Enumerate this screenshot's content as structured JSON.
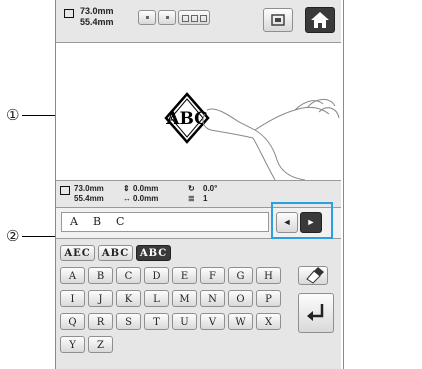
{
  "header": {
    "width": "73.0mm",
    "height": "55.4mm",
    "mode_buttons": [
      "",
      "",
      ""
    ],
    "icons": [
      "embroidery-frame-icon",
      "home-icon"
    ]
  },
  "canvas": {
    "monogram_text": "ABC",
    "annotation": "①"
  },
  "info_bar": {
    "width": "73.0mm",
    "height": "55.4mm",
    "offset_vertical": "0.0mm",
    "offset_horizontal": "0.0mm",
    "rotation": "0.0°",
    "color_count": "1"
  },
  "input": {
    "entered_chars": [
      "A",
      "B",
      "C"
    ],
    "arrow_left": "◄",
    "arrow_right": "►",
    "annotation": "②"
  },
  "keyboard": {
    "tabs": [
      "AEC",
      "ABC",
      "ABC"
    ],
    "selected_tab": 2,
    "rows": [
      [
        "A",
        "B",
        "C",
        "D",
        "E",
        "F",
        "G",
        "H"
      ],
      [
        "I",
        "J",
        "K",
        "L",
        "M",
        "N",
        "O",
        "P"
      ],
      [
        "Q",
        "R",
        "S",
        "T",
        "U",
        "V",
        "W",
        "X"
      ],
      [
        "Y",
        "Z"
      ]
    ],
    "icons": [
      "eraser-icon",
      "enter-icon"
    ]
  }
}
